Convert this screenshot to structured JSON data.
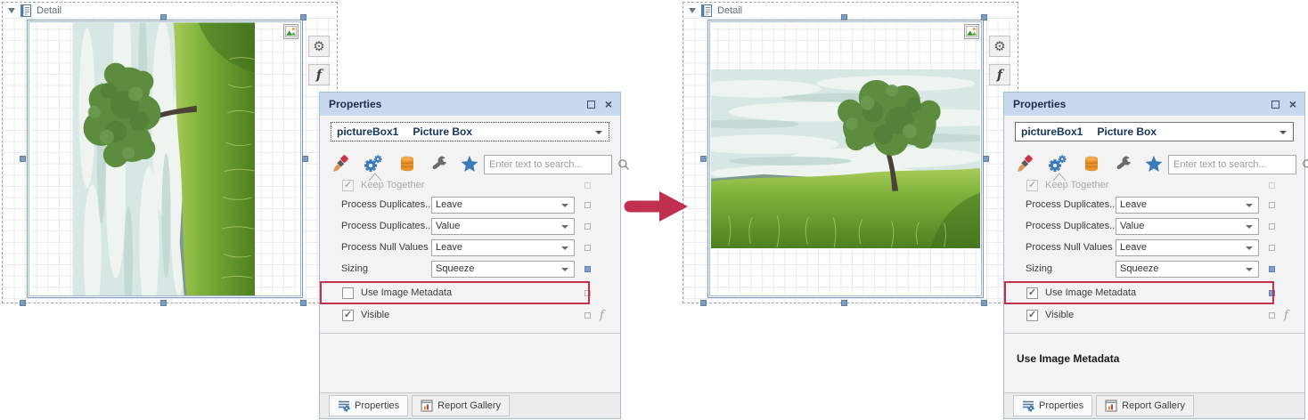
{
  "colors": {
    "highlight_red": "#c2314e",
    "arrow_red": "#c23050",
    "panel_header_blue": "#c7d8ef",
    "modified_marker_blue": "#7e9fce",
    "selection_handle_blue": "#7b9cc5"
  },
  "icons": {
    "gear_glyph": "⚙",
    "fx_glyph": "f",
    "close_glyph": "×",
    "check_glyph": "✓"
  },
  "surfaces": {
    "left": {
      "band_label": "Detail"
    },
    "right": {
      "band_label": "Detail"
    }
  },
  "panels": {
    "left": {
      "title": "Properties",
      "selector": {
        "name": "pictureBox1",
        "type": "Picture Box"
      },
      "search_placeholder": "Enter text to search...",
      "rows": [
        {
          "label": "Keep Together",
          "type": "checkbox",
          "checked": true,
          "disabled": true,
          "glyph": "✓"
        },
        {
          "label": "Process Duplicates...",
          "type": "dropdown",
          "value": "Leave"
        },
        {
          "label": "Process Duplicates...",
          "type": "dropdown",
          "value": "Value"
        },
        {
          "label": "Process Null Values",
          "type": "dropdown",
          "value": "Leave"
        },
        {
          "label": "Sizing",
          "type": "dropdown",
          "value": "Squeeze",
          "modified": true
        },
        {
          "label": "Use Image Metadata",
          "type": "checkbox",
          "checked": false,
          "highlighted": true,
          "glyph": ""
        },
        {
          "label": "Visible",
          "type": "checkbox",
          "checked": true,
          "glyph": "✓"
        }
      ],
      "fx_label": "f",
      "description": "",
      "tabs": [
        {
          "label": "Properties"
        },
        {
          "label": "Report Gallery"
        }
      ]
    },
    "right": {
      "title": "Properties",
      "selector": {
        "name": "pictureBox1",
        "type": "Picture Box"
      },
      "search_placeholder": "Enter text to search...",
      "rows": [
        {
          "label": "Keep Together",
          "type": "checkbox",
          "checked": true,
          "disabled": true,
          "glyph": "✓"
        },
        {
          "label": "Process Duplicates...",
          "type": "dropdown",
          "value": "Leave"
        },
        {
          "label": "Process Duplicates...",
          "type": "dropdown",
          "value": "Value"
        },
        {
          "label": "Process Null Values",
          "type": "dropdown",
          "value": "Leave"
        },
        {
          "label": "Sizing",
          "type": "dropdown",
          "value": "Squeeze",
          "modified": true
        },
        {
          "label": "Use Image Metadata",
          "type": "checkbox",
          "checked": true,
          "highlighted": true,
          "modified": true,
          "glyph": "✓"
        },
        {
          "label": "Visible",
          "type": "checkbox",
          "checked": true,
          "glyph": "✓"
        }
      ],
      "fx_label": "f",
      "description": "Use Image Metadata",
      "tabs": [
        {
          "label": "Properties"
        },
        {
          "label": "Report Gallery"
        }
      ]
    }
  }
}
